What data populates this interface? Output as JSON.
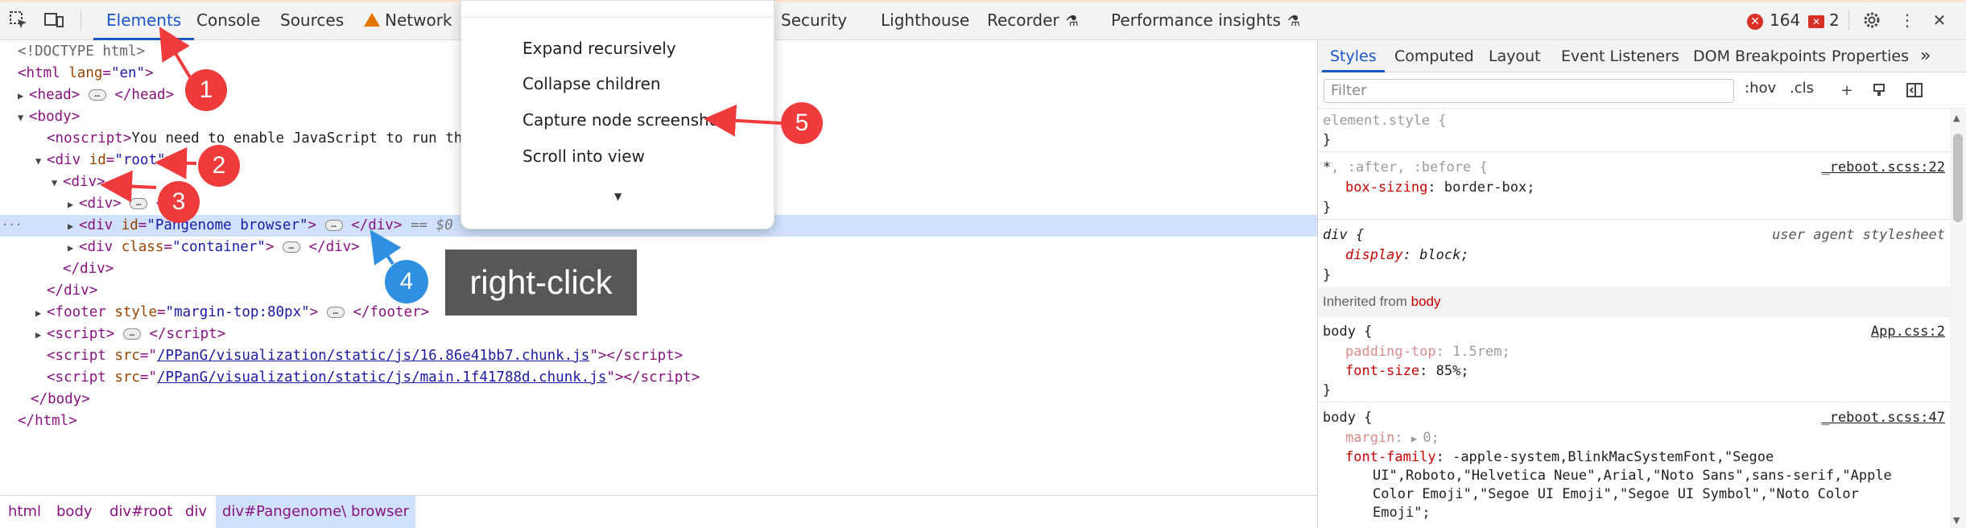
{
  "toolbar": {
    "tabs": [
      "Elements",
      "Console",
      "Sources",
      "Network",
      "Security",
      "Lighthouse",
      "Recorder",
      "Performance insights"
    ],
    "error_count": "164",
    "issue_count": "2"
  },
  "dom": {
    "doctype": "<!DOCTYPE html>",
    "html_open": "html",
    "lang_attr": "lang",
    "lang_val": "\"en\"",
    "head": "head",
    "body": "body",
    "noscript": "noscript",
    "noscript_text": "You need to enable JavaScript to run th",
    "div": "div",
    "id_attr": "id",
    "root_val": "\"root\"",
    "pangenome_val": "\"Pangenome browser\"",
    "class_attr": "class",
    "container_val": "\"container\"",
    "eq_dollar": "== $0",
    "footer": "footer",
    "style_attr": "style",
    "footer_style_val": "\"margin-top:80px\"",
    "script": "script",
    "src_attr": "src",
    "script1_src": "/PPanG/visualization/static/js/16.86e41bb7.chunk.js",
    "script2_src": "/PPanG/visualization/static/js/main.1f41788d.chunk.js",
    "html_close": "html"
  },
  "breadcrumbs": [
    "html",
    "body",
    "div#root",
    "div",
    "div#Pangenome\\ browser"
  ],
  "context_menu": {
    "items": [
      "Expand recursively",
      "Collapse children",
      "Capture node screenshot",
      "Scroll into view"
    ]
  },
  "styles_pane": {
    "tabs": [
      "Styles",
      "Computed",
      "Layout",
      "Event Listeners",
      "DOM Breakpoints",
      "Properties"
    ],
    "filter_placeholder": "Filter",
    "hov": ":hov",
    "cls": ".cls",
    "element_style": "element.style {",
    "close_brace": "}",
    "rule1_selector_main": "*",
    "rule1_selector_rest": ", :after, :before {",
    "rule1_source": "_reboot.scss:22",
    "rule1_prop": "box-sizing",
    "rule1_val": "border-box;",
    "rule2_selector": "div {",
    "rule2_source": "user agent stylesheet",
    "rule2_prop": "display",
    "rule2_val": "block;",
    "inherited_prefix": "Inherited from",
    "inherited_from": "body",
    "rule3_selector": "body {",
    "rule3_source": "App.css:2",
    "rule3_prop1": "padding-top",
    "rule3_val1": "1.5rem;",
    "rule3_prop2": "font-size",
    "rule3_val2": "85%;",
    "rule4_selector": "body {",
    "rule4_source": "_reboot.scss:47",
    "rule4_prop1": "margin",
    "rule4_val1": "0;",
    "rule4_prop2": "font-family",
    "rule4_val2_l1": "-apple-system,BlinkMacSystemFont,\"Segoe",
    "rule4_val2_l2": "UI\",Roboto,\"Helvetica Neue\",Arial,\"Noto Sans\",sans-serif,\"Apple",
    "rule4_val2_l3": "Color Emoji\",\"Segoe UI Emoji\",\"Segoe UI Symbol\",\"Noto Color",
    "rule4_val2_l4": "Emoji\";"
  },
  "annotations": {
    "numbers": [
      "1",
      "2",
      "3",
      "4",
      "5"
    ],
    "right_click": "right-click",
    "colors": {
      "red": "#ef3b3b",
      "blue": "#2f8fe0"
    }
  }
}
